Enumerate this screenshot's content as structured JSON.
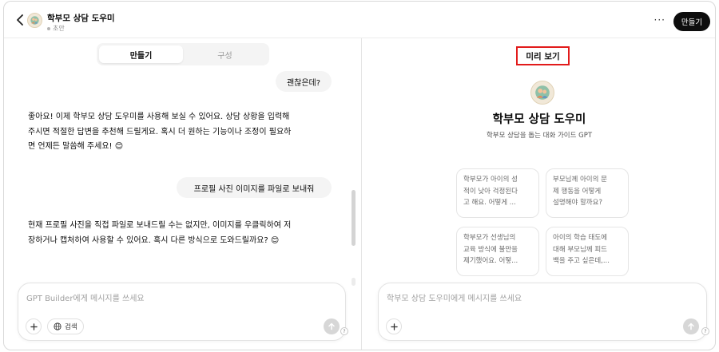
{
  "header": {
    "gpt_name": "학부모 상담 도우미",
    "status": "초안",
    "more": "···",
    "create_button": "만들기"
  },
  "builder": {
    "tabs": [
      {
        "label": "만들기",
        "active": true
      },
      {
        "label": "구성",
        "active": false
      }
    ],
    "messages": [
      {
        "role": "user",
        "text": "괜찮은데?"
      },
      {
        "role": "assistant",
        "lines": [
          "좋아요! 이제 학부모 상담 도우미를 사용해 보실 수 있어요. 상담 상황을 입력해",
          "주시면 적절한 답변을 추천해 드릴게요. 혹시 더 원하는 기능이나 조정이 필요하",
          "면 언제든 말씀해 주세요! 😊"
        ]
      },
      {
        "role": "user",
        "text": "프로필 사진 이미지를 파일로 보내줘"
      },
      {
        "role": "assistant",
        "lines": [
          "현재 프로필 사진을 직접 파일로 보내드릴 수는 없지만, 이미지를 우클릭하여 저",
          "장하거나 캡처하여 사용할 수 있어요. 혹시 다른 방식으로 도와드릴까요? 😊"
        ]
      }
    ],
    "composer": {
      "placeholder": "GPT Builder에게 메시지를 쓰세요",
      "search_label": "검색"
    }
  },
  "preview": {
    "label": "미리 보기",
    "title": "학부모 상담 도우미",
    "description": "학부모 상담을 돕는 대화 가이드 GPT",
    "starters": [
      [
        "학부모가 아이의 성",
        "적이 낮아 걱정된다",
        "고 해요. 어떻게 ..."
      ],
      [
        "부모님께 아이의 문",
        "제 행동을 어떻게",
        "설명해야 할까요?"
      ],
      [
        "학부모가 선생님의",
        "교육 방식에 불만을",
        "제기했어요. 어떻..."
      ],
      [
        "아이의 학습 태도에",
        "대해 부모님께 피드",
        "백을 주고 싶은데,..."
      ]
    ],
    "composer": {
      "placeholder": "학부모 상담 도우미에게 메시지를 쓰세요"
    }
  },
  "help": "?",
  "icons": {
    "back": "chevron-left-icon",
    "avatar": "parent-child-icon",
    "plus": "plus-icon",
    "globe": "globe-icon",
    "send": "arrow-up-icon"
  },
  "colors": {
    "accent_dark": "#0d0d0d",
    "highlight_border": "#e21b1b",
    "bubble_bg": "#f4f4f4"
  }
}
